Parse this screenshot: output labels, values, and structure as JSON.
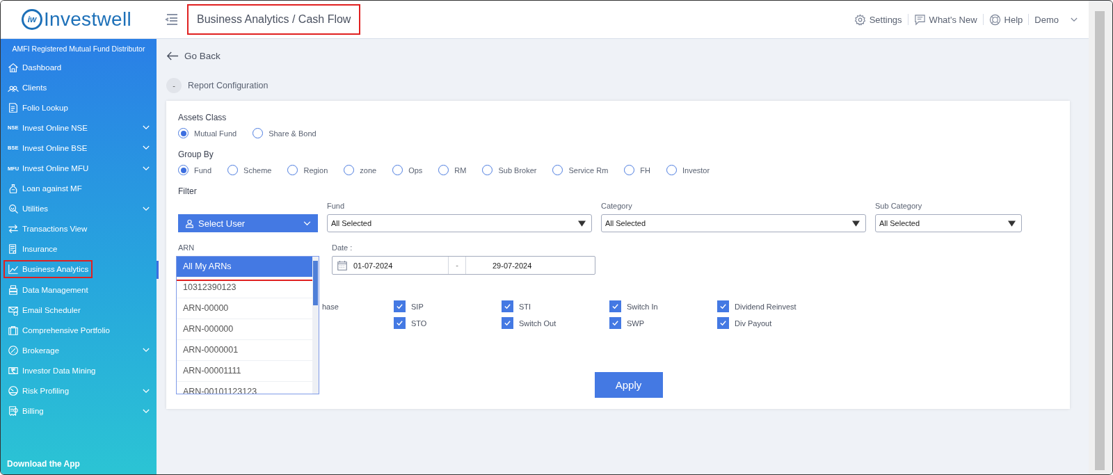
{
  "header": {
    "logo_mark": "iw",
    "logo_text": "Investwell",
    "breadcrumb": {
      "text": "Business Analytics / Cash Flow",
      "highlighted": true
    },
    "links": [
      {
        "label": "Settings",
        "kind": "gear"
      },
      {
        "label": "What's New",
        "kind": "chat"
      },
      {
        "label": "Help",
        "kind": "lifebuoy"
      },
      {
        "label": "Demo",
        "kind": "menu"
      }
    ]
  },
  "sidebar": {
    "tagline": "AMFI Registered Mutual Fund Distributor",
    "items": [
      {
        "label": "Dashboard",
        "kind": "icon",
        "expandable": false,
        "selected": false,
        "highlighted": false
      },
      {
        "label": "Clients",
        "kind": "icon",
        "expandable": false,
        "selected": false,
        "highlighted": false
      },
      {
        "label": "Folio Lookup",
        "kind": "icon",
        "expandable": false,
        "selected": false,
        "highlighted": false
      },
      {
        "label": "Invest Online NSE",
        "kind": "badge",
        "badge": "NSE",
        "expandable": true,
        "selected": false,
        "highlighted": false
      },
      {
        "label": "Invest Online BSE",
        "kind": "badge",
        "badge": "BSE",
        "expandable": true,
        "selected": false,
        "highlighted": false
      },
      {
        "label": "Invest Online MFU",
        "kind": "badge",
        "badge": "MFU",
        "expandable": true,
        "selected": false,
        "highlighted": false
      },
      {
        "label": "Loan against MF",
        "kind": "icon",
        "expandable": false,
        "selected": false,
        "highlighted": false
      },
      {
        "label": "Utilities",
        "kind": "icon",
        "expandable": true,
        "selected": false,
        "highlighted": false
      },
      {
        "label": "Transactions View",
        "kind": "icon",
        "expandable": false,
        "selected": false,
        "highlighted": false
      },
      {
        "label": "Insurance",
        "kind": "icon",
        "expandable": false,
        "selected": false,
        "highlighted": false
      },
      {
        "label": "Business Analytics",
        "kind": "icon",
        "expandable": false,
        "selected": true,
        "highlighted": true
      },
      {
        "label": "Data Management",
        "kind": "icon",
        "expandable": false,
        "selected": false,
        "highlighted": false
      },
      {
        "label": "Email Scheduler",
        "kind": "icon",
        "expandable": false,
        "selected": false,
        "highlighted": false
      },
      {
        "label": "Comprehensive Portfolio",
        "kind": "icon",
        "expandable": false,
        "selected": false,
        "highlighted": false
      },
      {
        "label": "Brokerage",
        "kind": "icon",
        "expandable": true,
        "selected": false,
        "highlighted": false
      },
      {
        "label": "Investor Data Mining",
        "kind": "icon",
        "expandable": false,
        "selected": false,
        "highlighted": false
      },
      {
        "label": "Risk Profiling",
        "kind": "icon",
        "expandable": true,
        "selected": false,
        "highlighted": false
      },
      {
        "label": "Billing",
        "kind": "icon",
        "expandable": true,
        "selected": false,
        "highlighted": false
      }
    ],
    "footer": "Download the App"
  },
  "go_back": "Go Back",
  "section": {
    "toggle": "-",
    "title": "Report Configuration"
  },
  "assets_class": {
    "label": "Assets Class",
    "options": [
      {
        "label": "Mutual Fund",
        "selected": true
      },
      {
        "label": "Share & Bond",
        "selected": false
      }
    ]
  },
  "group_by": {
    "label": "Group By",
    "options": [
      {
        "label": "Fund",
        "selected": true
      },
      {
        "label": "Scheme",
        "selected": false
      },
      {
        "label": "Region",
        "selected": false
      },
      {
        "label": "zone",
        "selected": false
      },
      {
        "label": "Ops",
        "selected": false
      },
      {
        "label": "RM",
        "selected": false
      },
      {
        "label": "Sub Broker",
        "selected": false
      },
      {
        "label": "Service Rm",
        "selected": false
      },
      {
        "label": "FH",
        "selected": false
      },
      {
        "label": "Investor",
        "selected": false
      }
    ]
  },
  "filter": {
    "label": "Filter",
    "select_user": "Select User",
    "selects": [
      {
        "label": "Fund",
        "value": "All Selected"
      },
      {
        "label": "Category",
        "value": "All Selected"
      },
      {
        "label": "Sub Category",
        "value": "All Selected"
      }
    ]
  },
  "arn": {
    "label": "ARN",
    "options": [
      {
        "label": "All My ARNs",
        "selected": true,
        "highlighted": true
      },
      {
        "label": "10312390123",
        "selected": false,
        "highlighted": false
      },
      {
        "label": "ARN-00000",
        "selected": false,
        "highlighted": false
      },
      {
        "label": "ARN-000000",
        "selected": false,
        "highlighted": false
      },
      {
        "label": "ARN-0000001",
        "selected": false,
        "highlighted": false
      },
      {
        "label": "ARN-00001111",
        "selected": false,
        "highlighted": false
      },
      {
        "label": "ARN-00101123123",
        "selected": false,
        "highlighted": false
      }
    ]
  },
  "date": {
    "label": "Date :",
    "from": "01-07-2024",
    "separator": "-",
    "to": "29-07-2024"
  },
  "transaction_rows": [
    {
      "cells": [
        {
          "kind": "partial",
          "label": "hase"
        },
        {
          "kind": "checkbox",
          "label": "SIP",
          "checked": true
        },
        {
          "kind": "checkbox",
          "label": "STI",
          "checked": true
        },
        {
          "kind": "checkbox",
          "label": "Switch In",
          "checked": true
        },
        {
          "kind": "checkbox",
          "label": "Dividend Reinvest",
          "checked": true
        }
      ]
    },
    {
      "cells": [
        {
          "kind": "checkbox",
          "label": "STO",
          "checked": true
        },
        {
          "kind": "checkbox",
          "label": "Switch Out",
          "checked": true
        },
        {
          "kind": "checkbox",
          "label": "SWP",
          "checked": true
        },
        {
          "kind": "checkbox",
          "label": "Div Payout",
          "checked": true
        }
      ]
    }
  ],
  "apply": "Apply"
}
